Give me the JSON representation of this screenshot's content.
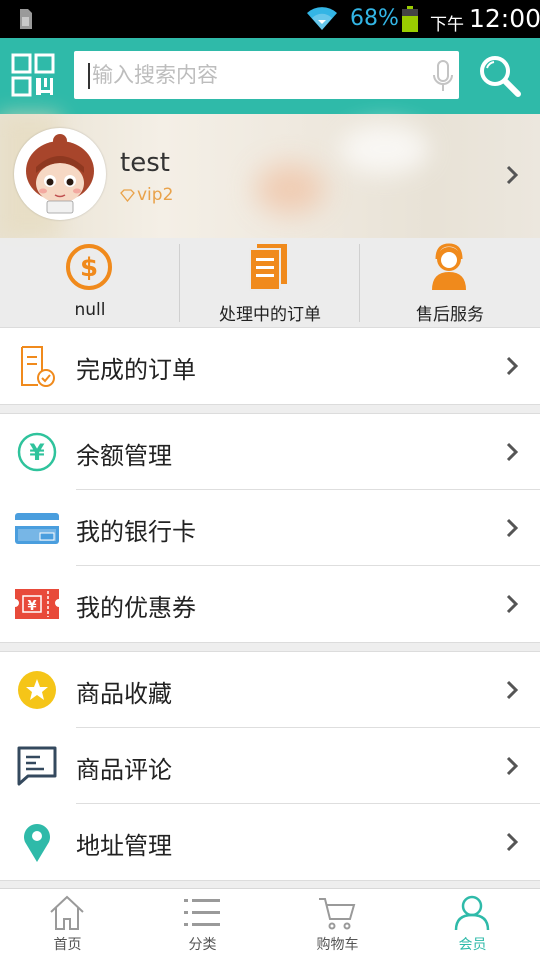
{
  "status_bar": {
    "battery_percent": "68%",
    "ampm": "下午",
    "time": "12:00",
    "accent": "#33b5e5"
  },
  "header": {
    "search_placeholder": "输入搜索内容",
    "bg": "#2fbaa9"
  },
  "profile": {
    "username": "test",
    "vip_level": "vip2"
  },
  "quick_actions": [
    {
      "icon": "dollar-coin-icon",
      "label": "null"
    },
    {
      "icon": "orders-document-icon",
      "label": "处理中的订单"
    },
    {
      "icon": "customer-service-icon",
      "label": "售后服务"
    }
  ],
  "menu_groups": [
    [
      {
        "icon": "completed-order-icon",
        "label": "完成的订单"
      }
    ],
    [
      {
        "icon": "yuan-balance-icon",
        "label": "余额管理"
      },
      {
        "icon": "bank-card-icon",
        "label": "我的银行卡"
      },
      {
        "icon": "coupon-icon",
        "label": "我的优惠券"
      }
    ],
    [
      {
        "icon": "star-favorite-icon",
        "label": "商品收藏"
      },
      {
        "icon": "comment-icon",
        "label": "商品评论"
      },
      {
        "icon": "location-pin-icon",
        "label": "地址管理"
      }
    ]
  ],
  "bottom_nav": [
    {
      "icon": "home-icon",
      "label": "首页",
      "active": false
    },
    {
      "icon": "list-icon",
      "label": "分类",
      "active": false
    },
    {
      "icon": "cart-icon",
      "label": "购物车",
      "active": false
    },
    {
      "icon": "user-icon",
      "label": "会员",
      "active": true
    }
  ]
}
